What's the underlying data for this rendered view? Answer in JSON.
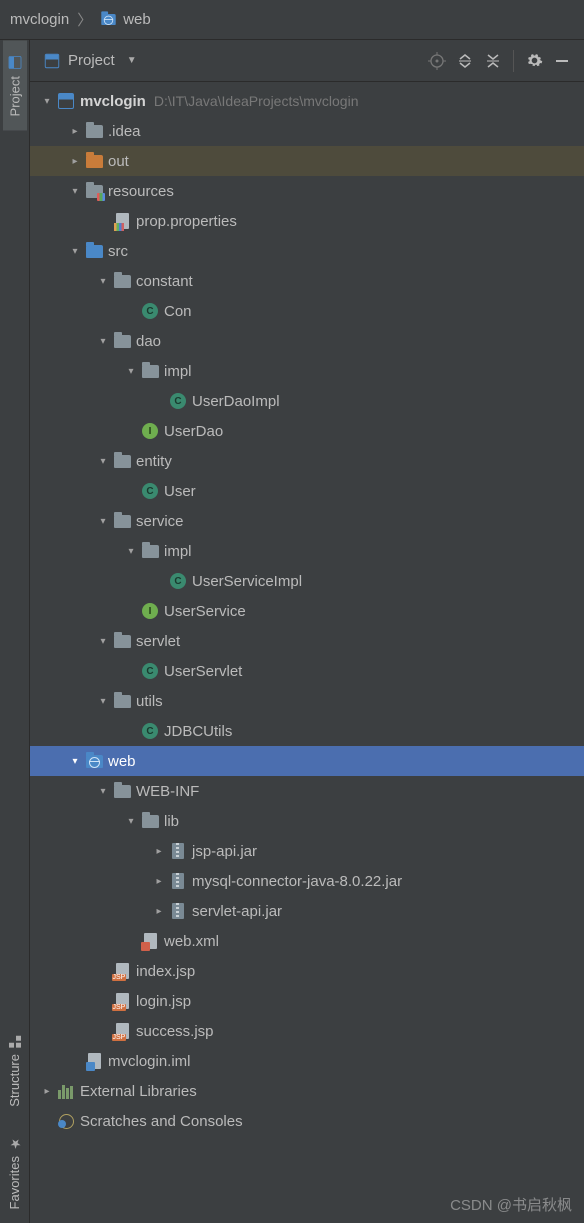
{
  "breadcrumb": {
    "items": [
      {
        "label": "mvclogin"
      },
      {
        "label": "web"
      }
    ]
  },
  "panel": {
    "view_label": "Project"
  },
  "side_tabs": {
    "project": "Project",
    "structure": "Structure",
    "favorites": "Favorites"
  },
  "tree": {
    "root": {
      "label": "mvclogin",
      "path_hint": "D:\\IT\\Java\\IdeaProjects\\mvclogin"
    },
    "nodes": {
      "idea": ".idea",
      "out": "out",
      "resources": "resources",
      "prop": "prop.properties",
      "src": "src",
      "constant": "constant",
      "con": "Con",
      "dao": "dao",
      "dao_impl": "impl",
      "userdaoimpl": "UserDaoImpl",
      "userdao": "UserDao",
      "entity": "entity",
      "user": "User",
      "service": "service",
      "service_impl": "impl",
      "userserviceimpl": "UserServiceImpl",
      "userservice": "UserService",
      "servlet": "servlet",
      "userservlet": "UserServlet",
      "utils": "utils",
      "jdbcutils": "JDBCUtils",
      "web": "web",
      "webinf": "WEB-INF",
      "lib": "lib",
      "jspapi": "jsp-api.jar",
      "mysql": "mysql-connector-java-8.0.22.jar",
      "servletapi": "servlet-api.jar",
      "webxml": "web.xml",
      "indexjsp": "index.jsp",
      "loginjsp": "login.jsp",
      "successjsp": "success.jsp",
      "iml": "mvclogin.iml",
      "extlib": "External Libraries",
      "scratch": "Scratches and Consoles"
    }
  },
  "watermark": "CSDN @书启秋枫"
}
